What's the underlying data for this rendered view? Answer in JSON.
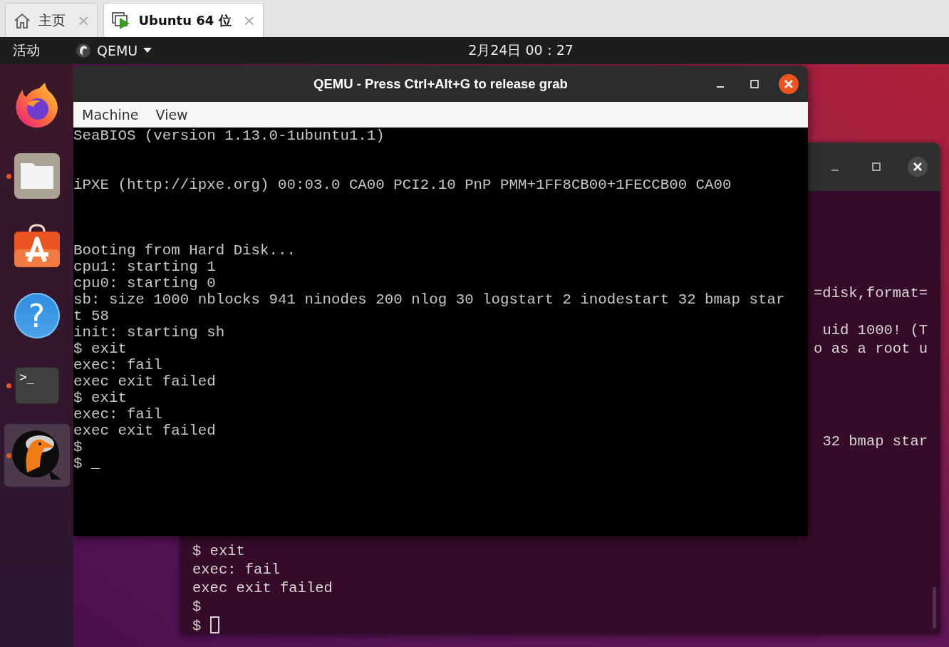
{
  "tabs": [
    {
      "label": "主页",
      "close": "×",
      "selected": false
    },
    {
      "label": "Ubuntu 64 位",
      "close": "×",
      "selected": true
    }
  ],
  "top_bar": {
    "activities": "活动",
    "app_menu": "QEMU",
    "clock": "2月24日  00：27"
  },
  "dock": [
    {
      "running": false,
      "selected": false
    },
    {
      "running": true,
      "selected": false
    },
    {
      "running": false,
      "selected": false
    },
    {
      "running": false,
      "selected": false,
      "glyph": "?"
    },
    {
      "running": true,
      "selected": false,
      "glyph": ">_"
    },
    {
      "running": true,
      "selected": true
    }
  ],
  "terminal_window": {
    "right_fragments": [
      [
        "=disk,format="
      ],
      [
        "uid 1000! (T",
        "o as a root u"
      ],
      [
        "32 bmap star"
      ]
    ],
    "lines": [
      "$ exit",
      "exec: fail",
      "exec exit failed",
      "$",
      "$"
    ],
    "cursor_focused": false
  },
  "qemu_window": {
    "title": "QEMU - Press Ctrl+Alt+G to release grab",
    "menu": [
      "Machine",
      "View"
    ],
    "console_blocks": [
      [
        "SeaBIOS (version 1.13.0-1ubuntu1.1)"
      ],
      [
        "iPXE (http://ipxe.org) 00:03.0 CA00 PCI2.10 PnP PMM+1FF8CB00+1FECCB00 CA00"
      ],
      [
        "Booting from Hard Disk...",
        "cpu1: starting 1",
        "cpu0: starting 0",
        "sb: size 1000 nblocks 941 ninodes 200 nlog 30 logstart 2 inodestart 32 bmap star",
        "t 58",
        "init: starting sh",
        "$ exit",
        "exec: fail",
        "exec exit failed",
        "$ exit",
        "exec: fail",
        "exec exit failed",
        "$",
        "$ _"
      ]
    ]
  }
}
